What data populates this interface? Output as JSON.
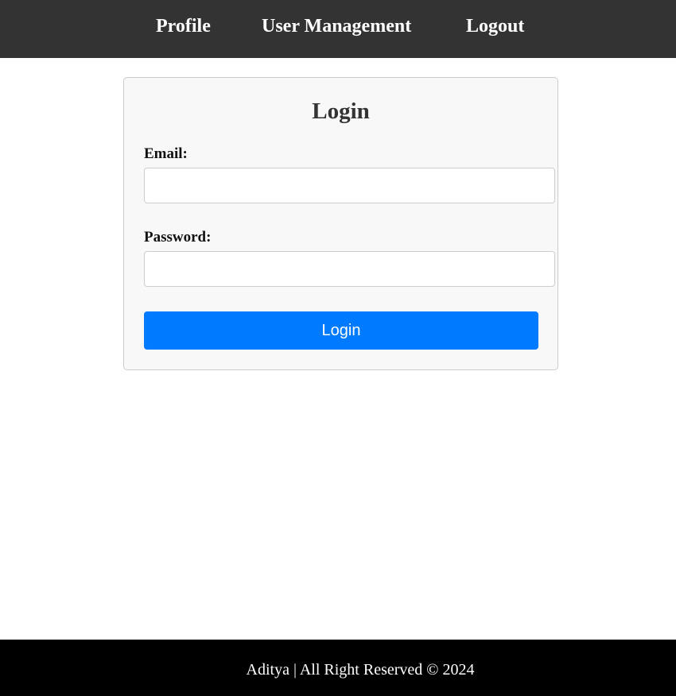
{
  "nav": {
    "items": [
      {
        "label": "Profile"
      },
      {
        "label": "User Management"
      },
      {
        "label": "Logout"
      }
    ],
    "background": "#333333",
    "text_color": "#ffffff"
  },
  "login_form": {
    "title": "Login",
    "email": {
      "label": "Email:",
      "value": "",
      "placeholder": ""
    },
    "password": {
      "label": "Password:",
      "value": "",
      "placeholder": ""
    },
    "submit_label": "Login",
    "submit_color": "#007bff",
    "card_background": "#f8f8f8"
  },
  "footer": {
    "text": "Aditya | All Right Reserved © 2024",
    "background": "#000000"
  }
}
